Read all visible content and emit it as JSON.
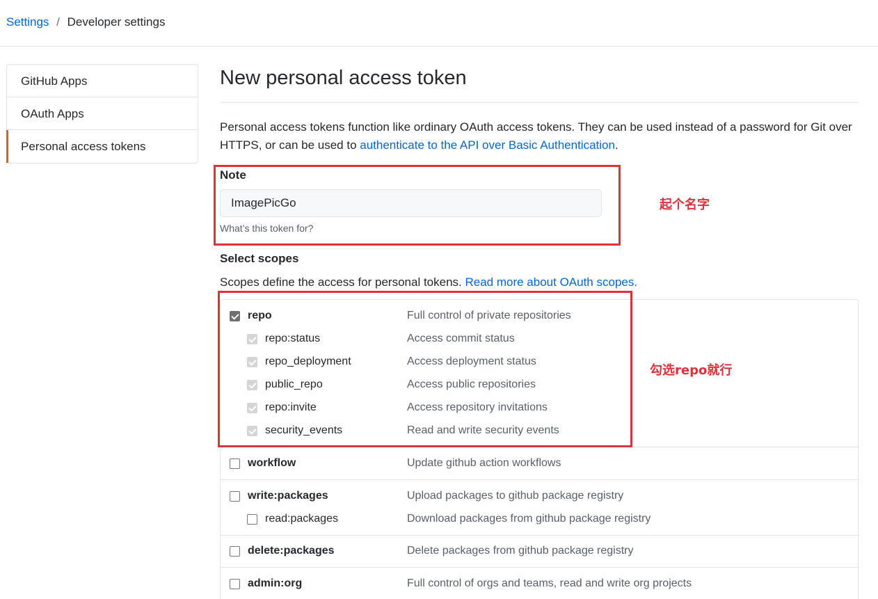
{
  "breadcrumb": {
    "root": "Settings",
    "separator": "/",
    "current": "Developer settings"
  },
  "sidebar": {
    "items": [
      {
        "label": "GitHub Apps",
        "selected": false
      },
      {
        "label": "OAuth Apps",
        "selected": false
      },
      {
        "label": "Personal access tokens",
        "selected": true
      }
    ]
  },
  "main": {
    "title": "New personal access token",
    "description_text": "Personal access tokens function like ordinary OAuth access tokens. They can be used instead of a password for Git over HTTPS, or can be used to ",
    "description_link": "authenticate to the API over Basic Authentication",
    "description_end": ".",
    "note": {
      "label": "Note",
      "value": "ImagePicGo",
      "hint": "What’s this token for?"
    },
    "scopes": {
      "label": "Select scopes",
      "description": "Scopes define the access for personal tokens. ",
      "link": "Read more about OAuth scopes.",
      "items": [
        {
          "name": "repo",
          "desc": "Full control of private repositories",
          "checked": true,
          "child": false
        },
        {
          "name": "repo:status",
          "desc": "Access commit status",
          "checked": true,
          "child": true
        },
        {
          "name": "repo_deployment",
          "desc": "Access deployment status",
          "checked": true,
          "child": true
        },
        {
          "name": "public_repo",
          "desc": "Access public repositories",
          "checked": true,
          "child": true
        },
        {
          "name": "repo:invite",
          "desc": "Access repository invitations",
          "checked": true,
          "child": true
        },
        {
          "name": "security_events",
          "desc": "Read and write security events",
          "checked": true,
          "child": true
        },
        {
          "name": "workflow",
          "desc": "Update github action workflows",
          "checked": false,
          "child": false
        },
        {
          "name": "write:packages",
          "desc": "Upload packages to github package registry",
          "checked": false,
          "child": false
        },
        {
          "name": "read:packages",
          "desc": "Download packages from github package registry",
          "checked": false,
          "child": true
        },
        {
          "name": "delete:packages",
          "desc": "Delete packages from github package registry",
          "checked": false,
          "child": false
        },
        {
          "name": "admin:org",
          "desc": "Full control of orgs and teams, read and write org projects",
          "checked": false,
          "child": false
        }
      ]
    }
  },
  "annotations": {
    "note_hint": "起个名字",
    "repo_hint": "勾选repo就行",
    "color": "#e0303a"
  },
  "colors": {
    "link": "#0366d6",
    "selected_accent": "#e36209"
  }
}
